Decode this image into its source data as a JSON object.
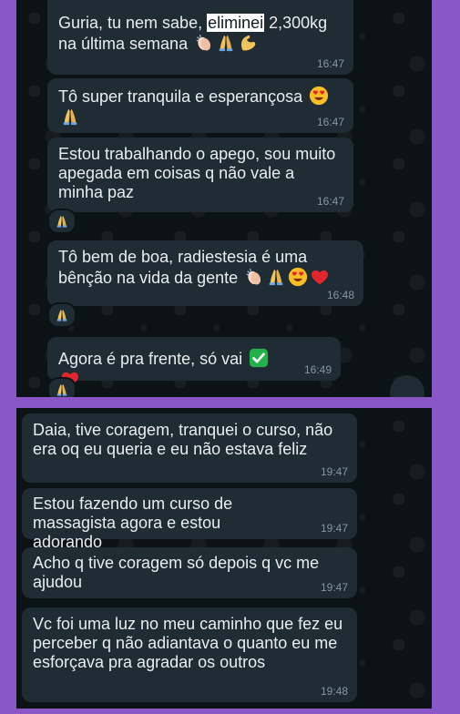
{
  "screenshot_top": {
    "messages": [
      {
        "text_before": "Guria, tu nem sabe, ",
        "highlighted": "eliminei",
        "text_after": " 2,300kg na última semana",
        "time": "16:47"
      },
      {
        "text": "Tô super tranquila e esperançosa",
        "time": "16:47"
      },
      {
        "text": "Estou trabalhando o apego, sou muito apegada em coisas q não vale a minha paz",
        "time": "16:47",
        "reaction": "pray-emoji"
      },
      {
        "text": "Tô bem de boa, radiestesia é uma bênção na vida da gente",
        "time": "16:48",
        "reaction": "pray-emoji"
      },
      {
        "text": "Agora é pra frente, só vai",
        "time": "16:49",
        "reaction": "pray-emoji"
      }
    ]
  },
  "screenshot_bottom": {
    "messages": [
      {
        "text": "Daia, tive coragem, tranquei o curso, não era oq eu queria e eu não estava feliz",
        "time": "19:47"
      },
      {
        "text": "Estou fazendo um curso de massagista agora e estou adorando",
        "time": "19:47"
      },
      {
        "text": "Acho q tive coragem só depois q vc me ajudou",
        "time": "19:47"
      },
      {
        "text": "Vc foi uma luz no meu caminho que fez eu perceber q não adiantava o quanto eu me esforçava pra agradar os outros",
        "time": "19:48"
      }
    ]
  },
  "colors": {
    "outer_background": "#8a55c4",
    "chat_background": "#0c1317",
    "bubble": "#1f2c33",
    "text": "#e9edef",
    "timestamp": "#8696a0"
  }
}
